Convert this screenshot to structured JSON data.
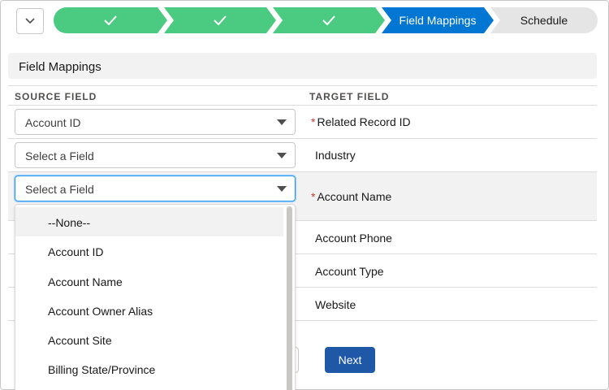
{
  "path": {
    "stages": [
      {
        "label": "",
        "status": "complete"
      },
      {
        "label": "",
        "status": "complete"
      },
      {
        "label": "",
        "status": "complete"
      },
      {
        "label": "Field Mappings",
        "status": "current"
      },
      {
        "label": "Schedule",
        "status": "incomplete"
      }
    ],
    "colors": {
      "complete": "#4bca81",
      "current": "#0176d3",
      "incomplete": "#e5e5e5"
    }
  },
  "section": {
    "title": "Field Mappings"
  },
  "columns": {
    "source": "SOURCE FIELD",
    "target": "TARGET FIELD"
  },
  "rows": [
    {
      "source": "Account ID",
      "target": "Related Record ID",
      "required": true
    },
    {
      "source": "Select a Field",
      "target": "Industry",
      "required": false
    },
    {
      "source": "Select a Field",
      "target": "Account Name",
      "required": true
    },
    {
      "source": "",
      "target": "Account Phone",
      "required": false
    },
    {
      "source": "",
      "target": "Account Type",
      "required": false
    },
    {
      "source": "",
      "target": "Website",
      "required": false
    }
  ],
  "required_marker": "*",
  "dropdown": {
    "options": [
      "--None--",
      "Account ID",
      "Account Name",
      "Account Owner Alias",
      "Account Site",
      "Billing State/Province"
    ],
    "highlighted": "--None--"
  },
  "footer": {
    "next_label": "Next"
  }
}
